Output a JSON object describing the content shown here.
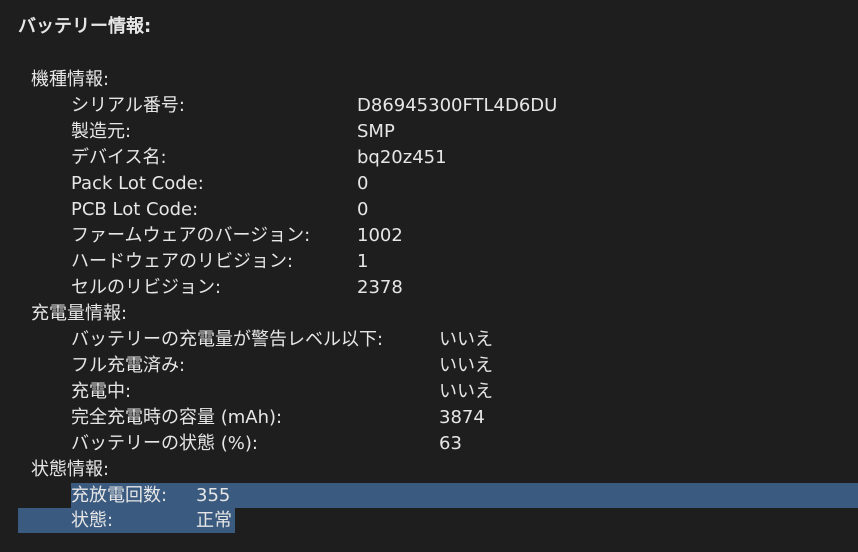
{
  "title": "バッテリー情報:",
  "sections": {
    "model_info": {
      "heading": "機種情報:",
      "items": [
        {
          "label": "シリアル番号:",
          "value": "D86945300FTL4D6DU"
        },
        {
          "label": "製造元:",
          "value": "SMP"
        },
        {
          "label": "デバイス名:",
          "value": "bq20z451"
        },
        {
          "label": "Pack Lot Code:",
          "value": "0"
        },
        {
          "label": "PCB Lot Code:",
          "value": "0"
        },
        {
          "label": "ファームウェアのバージョン:",
          "value": "1002"
        },
        {
          "label": "ハードウェアのリビジョン:",
          "value": "1"
        },
        {
          "label": "セルのリビジョン:",
          "value": "2378"
        }
      ]
    },
    "charge_info": {
      "heading": "充電量情報:",
      "items": [
        {
          "label": "バッテリーの充電量が警告レベル以下:",
          "value": "いいえ"
        },
        {
          "label": "フル充電済み:",
          "value": "いいえ"
        },
        {
          "label": "充電中:",
          "value": "いいえ"
        },
        {
          "label": "完全充電時の容量 (mAh):",
          "value": "3874"
        },
        {
          "label": "バッテリーの状態 (%):",
          "value": "63"
        }
      ]
    },
    "health_info": {
      "heading": "状態情報:",
      "items": [
        {
          "label": "充放電回数:",
          "value": "355"
        },
        {
          "label": "状態:",
          "value": "正常"
        }
      ]
    }
  },
  "colors": {
    "background": "#1e1e1e",
    "text": "#e6e6e6",
    "selection": "#3b5a80"
  }
}
